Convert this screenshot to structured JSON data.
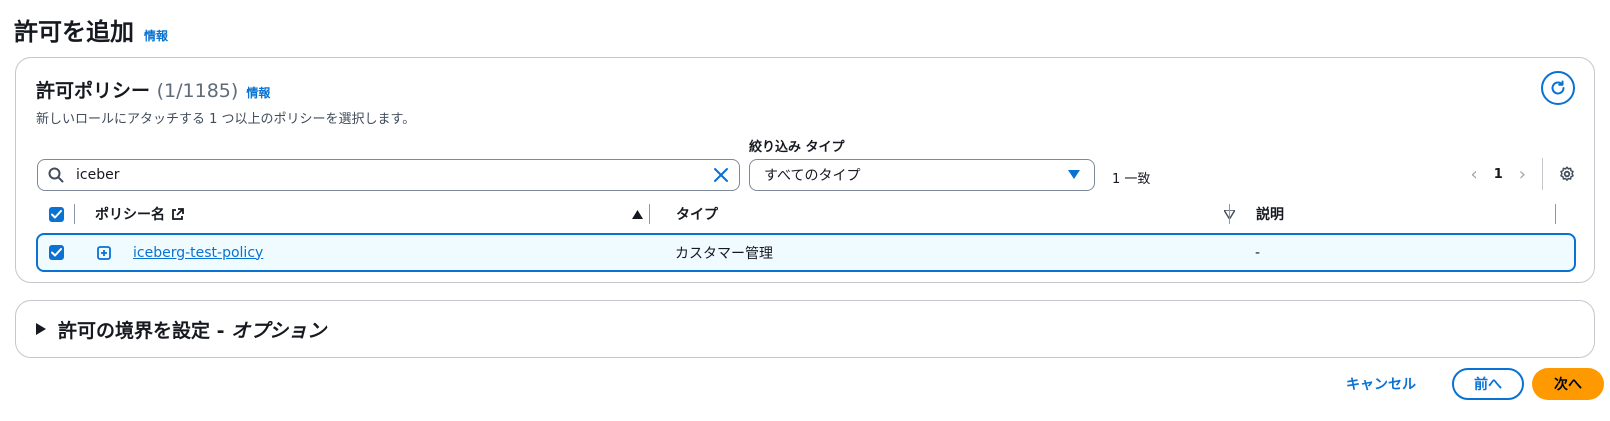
{
  "page": {
    "title": "許可を追加",
    "info_label": "情報"
  },
  "policies_panel": {
    "title": "許可ポリシー",
    "count": "(1/1185)",
    "info_label": "情報",
    "description": "新しいロールにアタッチする 1 つ以上のポリシーを選択します。",
    "refresh_icon": "refresh-icon"
  },
  "search": {
    "value": "iceber",
    "icon": "search-icon",
    "clear_icon": "clear-icon"
  },
  "filter": {
    "label": "絞り込み タイプ",
    "selected": "すべてのタイプ"
  },
  "match_count": "1 一致",
  "pagination": {
    "current_page": "1",
    "prev_icon": "chevron-left-icon",
    "next_icon": "chevron-right-icon",
    "settings_icon": "gear-icon"
  },
  "table": {
    "columns": {
      "name": "ポリシー名",
      "type": "タイプ",
      "description": "説明"
    },
    "rows": [
      {
        "name": "iceberg-test-policy",
        "type": "カスタマー管理",
        "description": "-",
        "selected": true
      }
    ]
  },
  "boundary": {
    "label": "許可の境界を設定 - ",
    "label_italic": "オプション"
  },
  "footer": {
    "cancel": "キャンセル",
    "previous": "前へ",
    "next": "次へ"
  },
  "colors": {
    "accent": "#0972d3",
    "primary_button": "#ff9900",
    "selected_row_bg": "#f0fbff"
  }
}
